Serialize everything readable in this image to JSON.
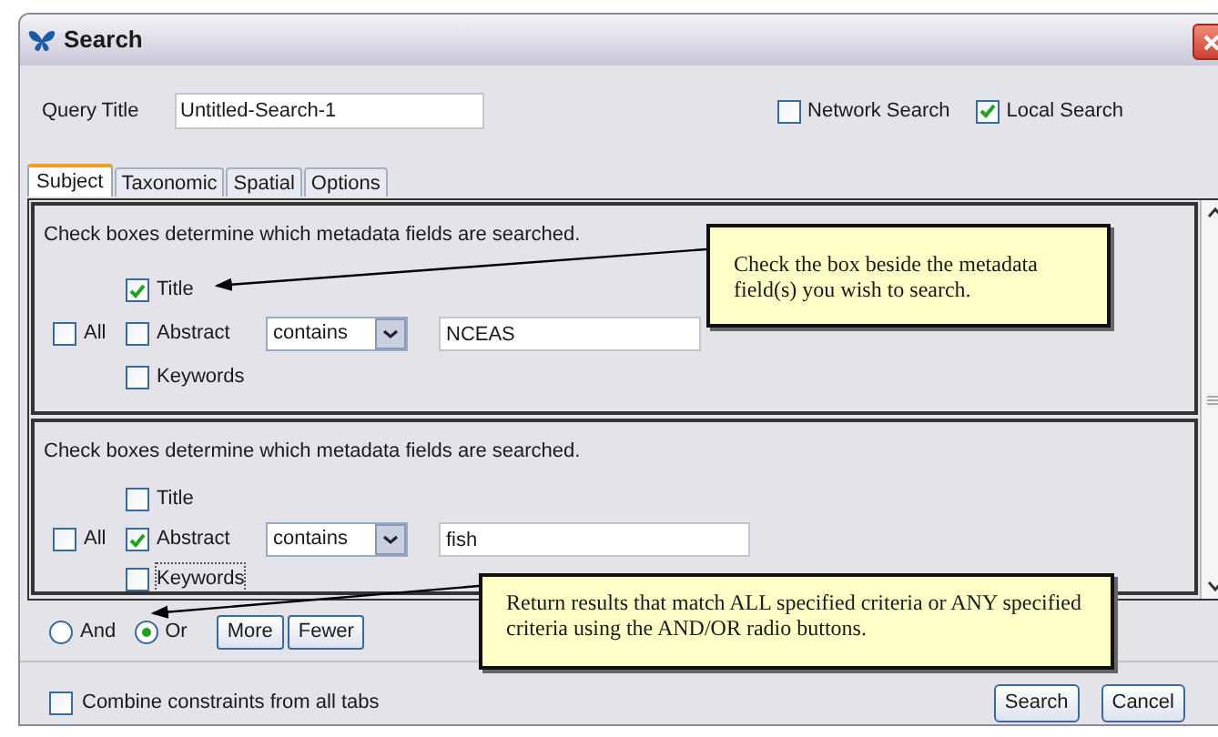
{
  "window": {
    "title": "Search"
  },
  "query": {
    "label": "Query Title",
    "value": "Untitled-Search-1"
  },
  "scopes": [
    {
      "label": "Network Search",
      "checked": false
    },
    {
      "label": "Local Search",
      "checked": true
    }
  ],
  "tabs": [
    {
      "label": "Subject",
      "selected": true
    },
    {
      "label": "Taxonomic",
      "selected": false
    },
    {
      "label": "Spatial",
      "selected": false
    },
    {
      "label": "Options",
      "selected": false
    }
  ],
  "criteria": [
    {
      "hint": "Check boxes determine which metadata fields are searched.",
      "all": {
        "label": "All",
        "checked": false
      },
      "fields": [
        {
          "label": "Title",
          "checked": true,
          "focused": false
        },
        {
          "label": "Abstract",
          "checked": false,
          "focused": false
        },
        {
          "label": "Keywords",
          "checked": false,
          "focused": false
        }
      ],
      "operator": "contains",
      "value": "NCEAS"
    },
    {
      "hint": "Check boxes determine which metadata fields are searched.",
      "all": {
        "label": "All",
        "checked": false
      },
      "fields": [
        {
          "label": "Title",
          "checked": false,
          "focused": false
        },
        {
          "label": "Abstract",
          "checked": true,
          "focused": false
        },
        {
          "label": "Keywords",
          "checked": false,
          "focused": true
        }
      ],
      "operator": "contains",
      "value": "fish"
    }
  ],
  "logic": [
    {
      "label": "And",
      "selected": false
    },
    {
      "label": "Or",
      "selected": true
    }
  ],
  "row_buttons": [
    "More",
    "Fewer"
  ],
  "combine": {
    "label": "Combine constraints from all tabs",
    "checked": false
  },
  "actions": [
    "Search",
    "Cancel"
  ],
  "callouts": [
    {
      "text": "Check the box beside the metadata field(s) you wish to search."
    },
    {
      "text": "Return results that match ALL specified criteria or ANY specified criteria using the AND/OR radio buttons."
    }
  ]
}
